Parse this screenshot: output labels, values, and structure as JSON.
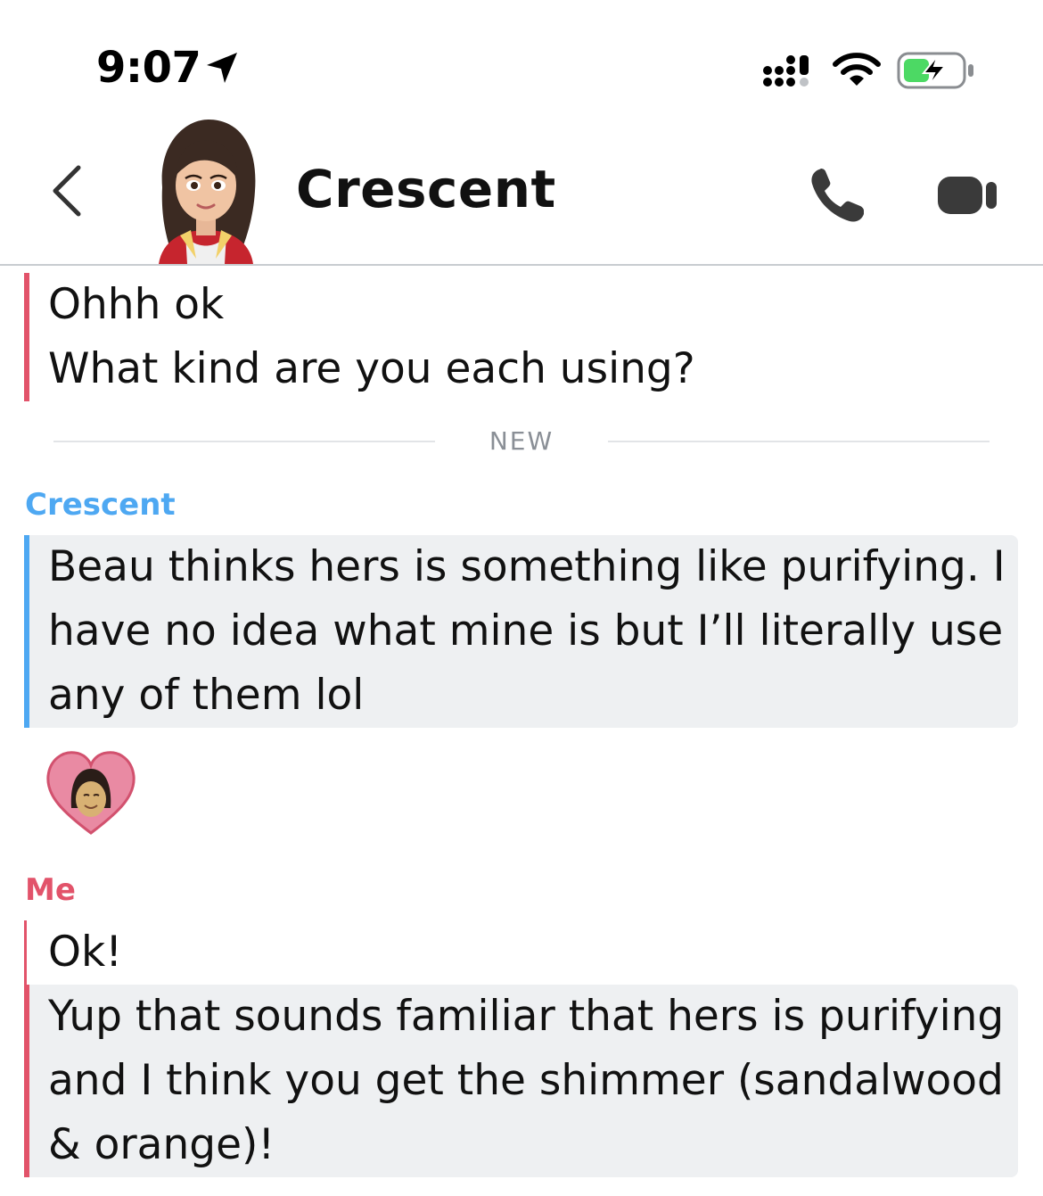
{
  "status_bar": {
    "time": "9:07",
    "icons": [
      "location-arrow-icon",
      "cellular-signal-icon",
      "wifi-icon",
      "battery-charging-icon"
    ]
  },
  "header": {
    "title": "Crescent",
    "icons": [
      "back-chevron-icon",
      "avatar",
      "phone-call-icon",
      "video-call-icon"
    ]
  },
  "messages": {
    "first": {
      "lines": [
        "Ohhh ok",
        "What kind are you each using?"
      ]
    },
    "new_divider_label": "NEW",
    "crescent": {
      "sender": "Crescent",
      "lines": [
        "Beau thinks hers is something like purifying. I",
        "have no idea what mine is but I’ll literally use",
        "any of them lol"
      ]
    },
    "reaction_icon": "heart-bitmoji-reaction-icon",
    "me": {
      "sender": "Me",
      "first_line": "Ok!",
      "lines": [
        "Yup that sounds familiar that hers is purifying",
        "and I think you get the shimmer (sandalwood",
        "& orange)!"
      ]
    }
  },
  "colors": {
    "me_accent": "#e2536a",
    "friend_accent": "#4ea8f2",
    "bubble_bg": "#eef0f2"
  }
}
